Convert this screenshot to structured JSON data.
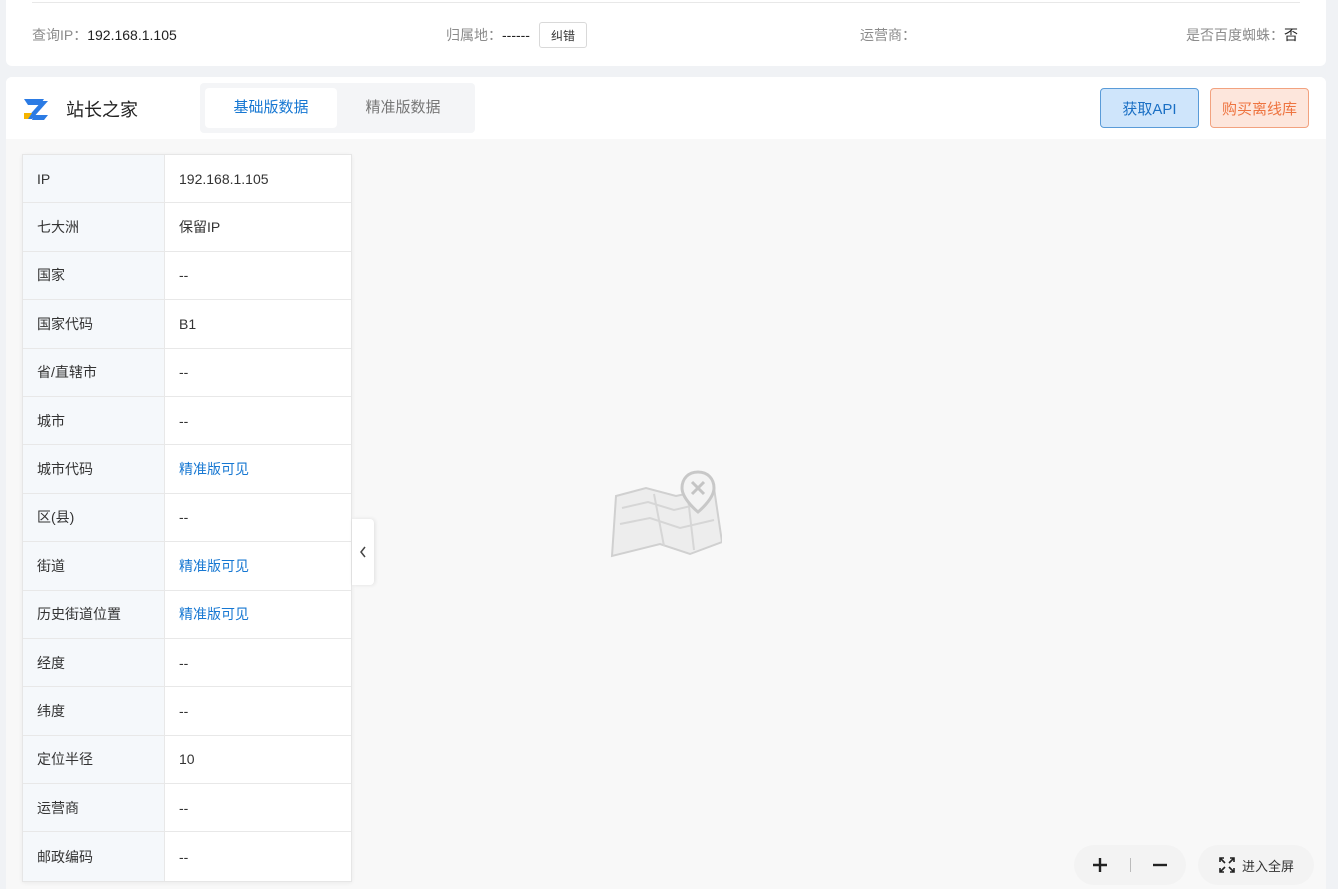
{
  "query": {
    "ip_label": "查询IP：",
    "ip_value": "192.168.1.105",
    "location_label": "归属地：",
    "location_value": "------",
    "correct_button": "纠错",
    "isp_label": "运营商：",
    "isp_value": "",
    "spider_label": "是否百度蜘蛛：",
    "spider_value": "否"
  },
  "header": {
    "brand": "站长之家",
    "tabs": [
      {
        "label": "基础版数据",
        "active": true
      },
      {
        "label": "精准版数据",
        "active": false
      }
    ],
    "api_button": "获取API",
    "buy_button": "购买离线库"
  },
  "info_rows": [
    {
      "key": "IP",
      "value": "192.168.1.105",
      "link": false
    },
    {
      "key": "七大洲",
      "value": "保留IP",
      "link": false
    },
    {
      "key": "国家",
      "value": "--",
      "link": false
    },
    {
      "key": "国家代码",
      "value": "B1",
      "link": false
    },
    {
      "key": "省/直辖市",
      "value": "--",
      "link": false
    },
    {
      "key": "城市",
      "value": "--",
      "link": false
    },
    {
      "key": "城市代码",
      "value": "精准版可见",
      "link": true
    },
    {
      "key": "区(县)",
      "value": "--",
      "link": false
    },
    {
      "key": "街道",
      "value": "精准版可见",
      "link": true
    },
    {
      "key": "历史街道位置",
      "value": "精准版可见",
      "link": true
    },
    {
      "key": "经度",
      "value": "--",
      "link": false
    },
    {
      "key": "纬度",
      "value": "--",
      "link": false
    },
    {
      "key": "定位半径",
      "value": "10",
      "link": false
    },
    {
      "key": "运营商",
      "value": "--",
      "link": false
    },
    {
      "key": "邮政编码",
      "value": "--",
      "link": false
    }
  ],
  "map_controls": {
    "fullscreen_label": "进入全屏"
  },
  "icons": {
    "logo": "zhanzhang-logo-icon",
    "collapse": "chevron-left-icon",
    "map_empty": "map-location-error-icon",
    "zoom_in": "plus-icon",
    "zoom_out": "minus-icon",
    "fullscreen": "fullscreen-icon"
  },
  "colors": {
    "primary": "#1677d2",
    "api_bg": "#cfe5fb",
    "buy_bg": "#fde6dc",
    "buy_text": "#ee7440"
  }
}
